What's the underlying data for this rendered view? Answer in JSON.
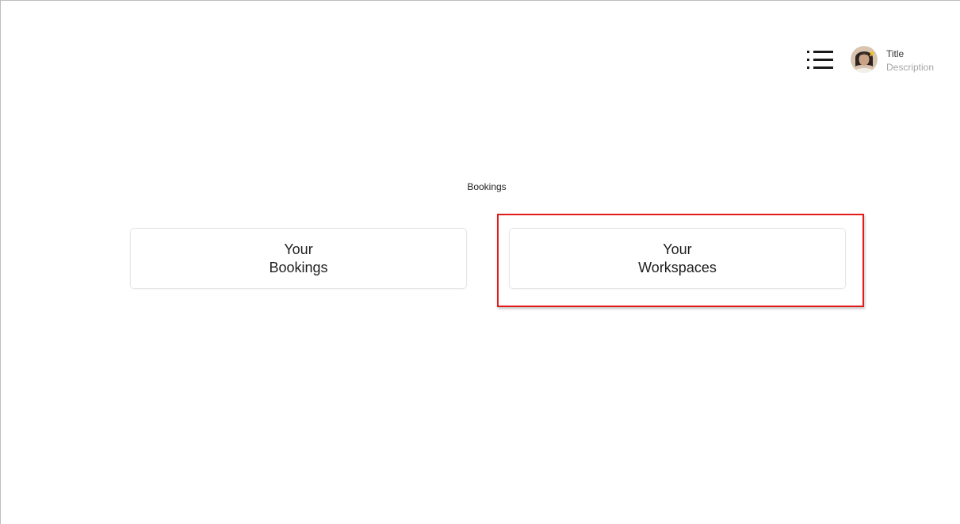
{
  "header": {
    "menu_icon": "list-menu-icon",
    "user": {
      "avatar_icon": "user-avatar",
      "title": "Title",
      "description": "Description"
    }
  },
  "main": {
    "section_label": "Bookings",
    "cards": [
      {
        "line1": "Your",
        "line2": "Bookings"
      },
      {
        "line1": "Your",
        "line2": "Workspaces"
      }
    ]
  },
  "colors": {
    "highlight": "#e41a1a",
    "card_border": "#e6e6e6",
    "muted_text": "#a6a6a6"
  }
}
